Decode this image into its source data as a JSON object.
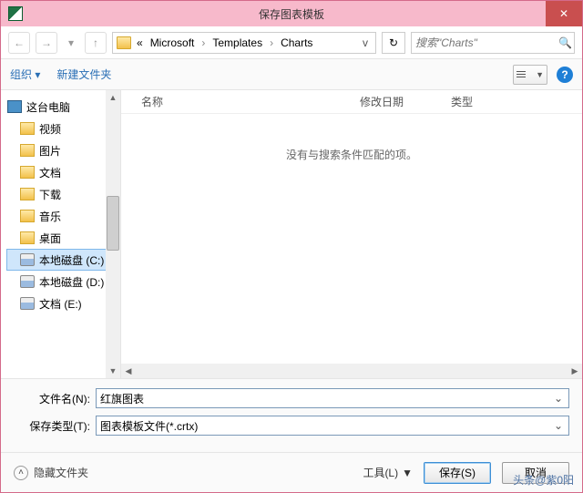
{
  "titlebar": {
    "title": "保存图表模板"
  },
  "nav": {
    "crumb_prefix": "«",
    "crumbs": [
      "Microsoft",
      "Templates",
      "Charts"
    ],
    "search_placeholder": "搜索\"Charts\""
  },
  "toolbar": {
    "organize": "组织 ▾",
    "newfolder": "新建文件夹"
  },
  "tree": {
    "root": "这台电脑",
    "items": [
      "视频",
      "图片",
      "文档",
      "下载",
      "音乐",
      "桌面",
      "本地磁盘 (C:)",
      "本地磁盘 (D:)",
      "文档 (E:)"
    ]
  },
  "cols": {
    "name": "名称",
    "date": "修改日期",
    "type": "类型"
  },
  "empty_msg": "没有与搜索条件匹配的项。",
  "form": {
    "filename_label": "文件名(N):",
    "filename_value": "红旗图表",
    "type_label": "保存类型(T):",
    "type_value": "图表模板文件(*.crtx)"
  },
  "footer": {
    "hide": "隐藏文件夹",
    "tools": "工具(L)",
    "save": "保存(S)",
    "cancel": "取消",
    "watermark": "头条@紫0阳"
  }
}
